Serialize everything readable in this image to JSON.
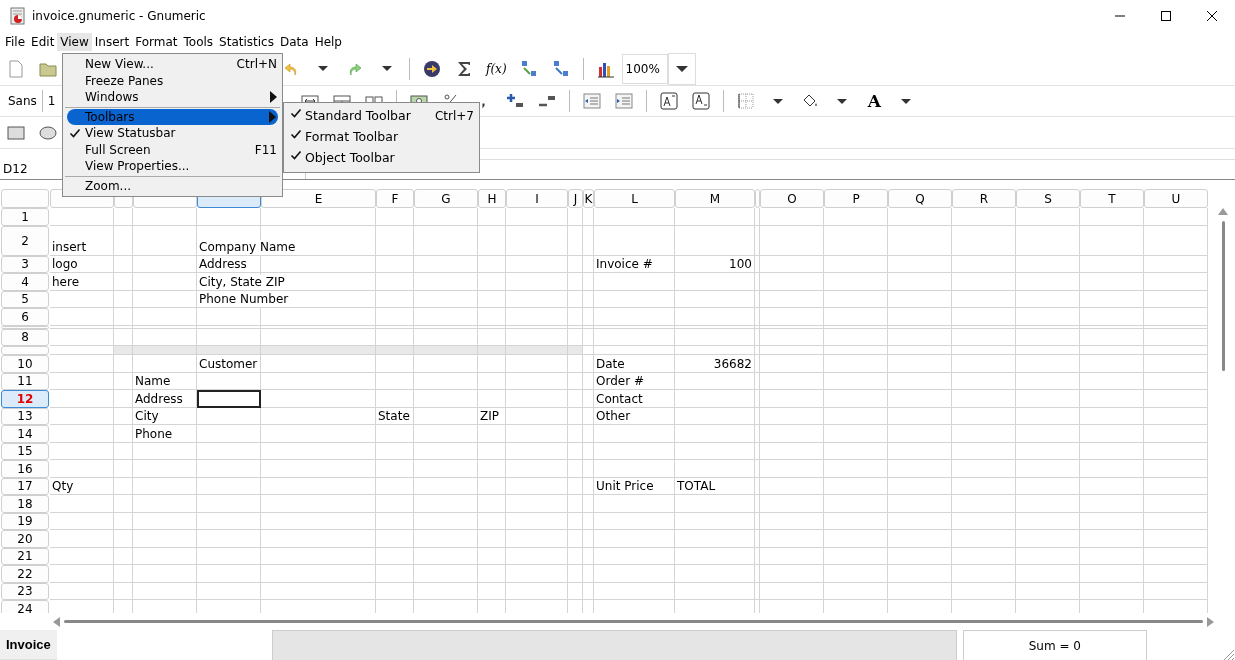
{
  "window": {
    "title": "invoice.gnumeric - Gnumeric"
  },
  "menubar": [
    {
      "label": "File",
      "selected": false
    },
    {
      "label": "Edit",
      "selected": false
    },
    {
      "label": "View",
      "selected": true
    },
    {
      "label": "Insert",
      "selected": false
    },
    {
      "label": "Format",
      "selected": false
    },
    {
      "label": "Tools",
      "selected": false
    },
    {
      "label": "Statistics",
      "selected": false
    },
    {
      "label": "Data",
      "selected": false
    },
    {
      "label": "Help",
      "selected": false
    }
  ],
  "standard_toolbar": {
    "start": [
      {
        "kind": "new-file"
      },
      {
        "kind": "open-folder"
      }
    ],
    "end": [
      {
        "kind": "separator"
      },
      {
        "kind": "undo"
      },
      {
        "kind": "dropdown"
      },
      {
        "kind": "redo"
      },
      {
        "kind": "dropdown"
      },
      {
        "kind": "separator"
      },
      {
        "kind": "goto"
      },
      {
        "kind": "sigma"
      },
      {
        "kind": "function",
        "label": "f(x)"
      },
      {
        "kind": "sort-ascending"
      },
      {
        "kind": "sort-descending"
      },
      {
        "kind": "separator"
      },
      {
        "kind": "chart"
      },
      {
        "kind": "zoom-field",
        "value": "100%"
      },
      {
        "kind": "dropdown-button"
      }
    ]
  },
  "format_toolbar": {
    "start": [
      {
        "kind": "font-name",
        "label": "Sans"
      },
      {
        "kind": "separator"
      },
      {
        "kind": "font-size",
        "label": "1"
      }
    ],
    "end": [
      {
        "kind": "merge"
      },
      {
        "kind": "center-across"
      },
      {
        "kind": "split"
      },
      {
        "kind": "separator"
      },
      {
        "kind": "currency"
      },
      {
        "kind": "percent"
      },
      {
        "kind": "comma"
      },
      {
        "kind": "add-decimal"
      },
      {
        "kind": "remove-decimal"
      },
      {
        "kind": "separator"
      },
      {
        "kind": "outdent"
      },
      {
        "kind": "indent"
      },
      {
        "kind": "separator"
      },
      {
        "kind": "superscript"
      },
      {
        "kind": "subscript"
      },
      {
        "kind": "separator"
      },
      {
        "kind": "borders"
      },
      {
        "kind": "dropdown"
      },
      {
        "kind": "fill"
      },
      {
        "kind": "dropdown"
      },
      {
        "kind": "font-color",
        "label": "A"
      },
      {
        "kind": "dropdown"
      }
    ]
  },
  "object_toolbar": [
    {
      "kind": "rectangle"
    },
    {
      "kind": "ellipse"
    }
  ],
  "formula_bar": {
    "cell_reference": "D12"
  },
  "view_menu": [
    {
      "kind": "item",
      "label": "New View...",
      "shortcut": "Ctrl+N",
      "checked": false,
      "submenu": false,
      "selected": false
    },
    {
      "kind": "item",
      "label": "Freeze Panes",
      "checked": false,
      "submenu": false,
      "selected": false
    },
    {
      "kind": "item",
      "label": "Windows",
      "checked": false,
      "submenu": true,
      "selected": false
    },
    {
      "kind": "separator"
    },
    {
      "kind": "item",
      "label": "Toolbars",
      "checked": false,
      "submenu": true,
      "selected": true
    },
    {
      "kind": "item",
      "label": "View Statusbar",
      "checked": true,
      "submenu": false,
      "selected": false
    },
    {
      "kind": "item",
      "label": "Full Screen",
      "shortcut": "F11",
      "checked": false,
      "submenu": false,
      "selected": false
    },
    {
      "kind": "item",
      "label": "View Properties...",
      "checked": false,
      "submenu": false,
      "selected": false
    },
    {
      "kind": "separator"
    },
    {
      "kind": "item",
      "label": "Zoom...",
      "checked": false,
      "submenu": false,
      "selected": false
    }
  ],
  "toolbars_submenu": [
    {
      "label": "Standard Toolbar",
      "shortcut": "Ctrl+7",
      "checked": true
    },
    {
      "label": "Format Toolbar",
      "checked": true
    },
    {
      "label": "Object Toolbar",
      "checked": true
    }
  ],
  "sheet": {
    "columns": [
      {
        "selected": false
      },
      {
        "selected": false
      },
      {
        "selected": false
      },
      {
        "selected": true
      },
      {
        "label": "E",
        "selected": false
      },
      {
        "label": "F",
        "selected": false
      },
      {
        "label": "G",
        "selected": false
      },
      {
        "label": "H",
        "selected": false
      },
      {
        "label": "I",
        "selected": false
      },
      {
        "label": "J",
        "selected": false
      },
      {
        "label": "K",
        "selected": false
      },
      {
        "label": "L",
        "selected": false
      },
      {
        "label": "M",
        "selected": false
      },
      {
        "selected": false
      },
      {
        "label": "O",
        "selected": false
      },
      {
        "label": "P",
        "selected": false
      },
      {
        "label": "Q",
        "selected": false
      },
      {
        "label": "R",
        "selected": false
      },
      {
        "label": "S",
        "selected": false
      },
      {
        "label": "T",
        "selected": false
      },
      {
        "label": "U",
        "selected": false
      }
    ],
    "rows": [
      {
        "label": "1",
        "kind": "normal",
        "selected": false,
        "cells": []
      },
      {
        "label": "2",
        "kind": "tall",
        "selected": false,
        "cells": [
          {
            "text": "insert",
            "kind": "text"
          },
          null,
          null,
          {
            "text": "Company Name",
            "kind": "text"
          }
        ]
      },
      {
        "label": "3",
        "kind": "normal",
        "selected": false,
        "cells": [
          {
            "text": "logo",
            "kind": "text"
          },
          null,
          null,
          {
            "text": "Address",
            "kind": "text"
          },
          null,
          null,
          null,
          null,
          null,
          null,
          null,
          {
            "text": "Invoice #",
            "kind": "text"
          },
          {
            "text": "100",
            "kind": "number"
          }
        ]
      },
      {
        "label": "4",
        "kind": "normal",
        "selected": false,
        "cells": [
          {
            "text": "here",
            "kind": "text"
          },
          null,
          null,
          {
            "text": "City, State  ZIP",
            "kind": "text"
          }
        ]
      },
      {
        "label": "5",
        "kind": "normal",
        "selected": false,
        "cells": [
          null,
          null,
          null,
          {
            "text": "Phone Number",
            "kind": "text"
          }
        ]
      },
      {
        "label": "6",
        "kind": "normal",
        "selected": false,
        "cells": []
      },
      {
        "kind": "collapsed",
        "selected": false,
        "cells": []
      },
      {
        "label": "8",
        "kind": "normal",
        "selected": false,
        "cells": []
      },
      {
        "kind": "shaded",
        "selected": false,
        "cells": []
      },
      {
        "label": "10",
        "kind": "normal",
        "selected": false,
        "cells": [
          null,
          null,
          null,
          {
            "text": "Customer",
            "kind": "text"
          },
          null,
          null,
          null,
          null,
          null,
          null,
          null,
          {
            "text": "Date",
            "kind": "text"
          },
          {
            "text": "36682",
            "kind": "number"
          }
        ]
      },
      {
        "label": "11",
        "kind": "normal",
        "selected": false,
        "cells": [
          null,
          null,
          {
            "text": "Name",
            "kind": "text"
          },
          null,
          null,
          null,
          null,
          null,
          null,
          null,
          null,
          {
            "text": "Order #",
            "kind": "text"
          }
        ]
      },
      {
        "label": "12",
        "kind": "normal",
        "selected": true,
        "cells": [
          null,
          null,
          {
            "text": "Address",
            "kind": "text"
          },
          null,
          null,
          null,
          null,
          null,
          null,
          null,
          null,
          {
            "text": "Contact",
            "kind": "text"
          }
        ]
      },
      {
        "label": "13",
        "kind": "normal",
        "selected": false,
        "cells": [
          null,
          null,
          {
            "text": "City",
            "kind": "text"
          },
          null,
          null,
          {
            "text": "State",
            "kind": "text"
          },
          null,
          {
            "text": "ZIP",
            "kind": "text"
          },
          null,
          null,
          null,
          {
            "text": "Other",
            "kind": "text"
          }
        ]
      },
      {
        "label": "14",
        "kind": "normal",
        "selected": false,
        "cells": [
          null,
          null,
          {
            "text": "Phone",
            "kind": "text"
          }
        ]
      },
      {
        "label": "15",
        "kind": "normal",
        "selected": false,
        "cells": []
      },
      {
        "label": "16",
        "kind": "normal",
        "selected": false,
        "cells": []
      },
      {
        "label": "17",
        "kind": "normal",
        "selected": false,
        "cells": [
          {
            "text": "Qty",
            "kind": "text"
          },
          null,
          null,
          null,
          null,
          null,
          null,
          null,
          null,
          null,
          null,
          {
            "text": "Unit Price",
            "kind": "text"
          },
          {
            "text": "TOTAL",
            "kind": "text"
          }
        ]
      },
      {
        "label": "18",
        "kind": "normal",
        "selected": false,
        "cells": []
      },
      {
        "label": "19",
        "kind": "normal",
        "selected": false,
        "cells": []
      },
      {
        "label": "20",
        "kind": "normal",
        "selected": false,
        "cells": []
      },
      {
        "label": "21",
        "kind": "normal",
        "selected": false,
        "cells": []
      },
      {
        "label": "22",
        "kind": "normal",
        "selected": false,
        "cells": []
      },
      {
        "label": "23",
        "kind": "normal",
        "selected": false,
        "cells": []
      },
      {
        "label": "24",
        "kind": "normal",
        "selected": false,
        "cells": []
      }
    ]
  },
  "sheet_tabs": [
    {
      "label": "Invoice",
      "selected": true
    }
  ],
  "status_bar": {
    "sum": "Sum = 0"
  }
}
